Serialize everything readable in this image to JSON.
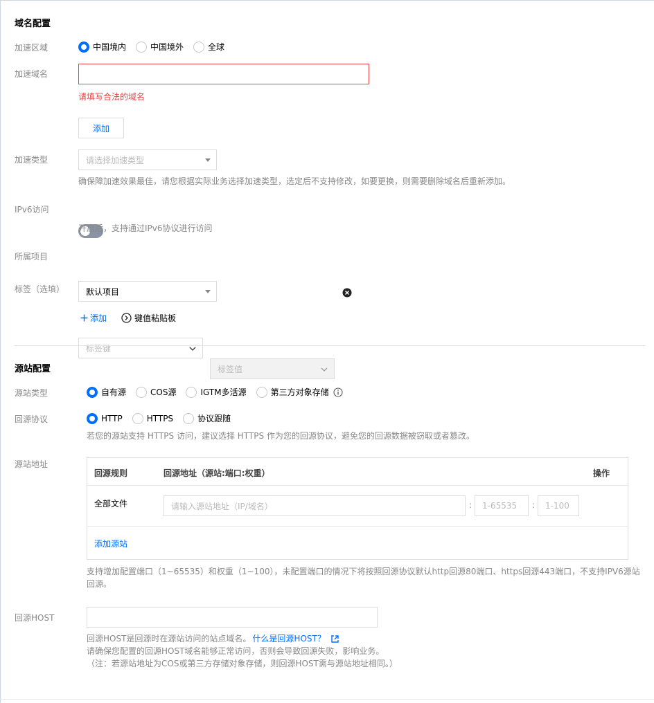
{
  "domain_config": {
    "title": "域名配置",
    "region": {
      "label": "加速区域",
      "options": [
        "中国境内",
        "中国境外",
        "全球"
      ],
      "selected": 0
    },
    "domain": {
      "label": "加速域名",
      "value": "",
      "error": "请填写合法的域名",
      "add_button": "添加"
    },
    "type": {
      "label": "加速类型",
      "placeholder": "请选择加速类型",
      "help": "确保障加速效果最佳，请您根据实际业务选择加速类型，选定后不支持修改，如要更换，则需要删除域名后重新添加。"
    },
    "ipv6": {
      "label": "IPv6访问",
      "enabled": false,
      "help": "开启后，支持通过IPv6协议进行访问"
    },
    "project": {
      "label": "所属项目",
      "value": "默认项目"
    },
    "tags": {
      "label": "标签（选填）",
      "key_placeholder": "标签键",
      "value_placeholder": "标签值",
      "add_link": "添加",
      "paste_link": "键值粘贴板"
    }
  },
  "origin_config": {
    "title": "源站配置",
    "origin_type": {
      "label": "源站类型",
      "options": [
        "自有源",
        "COS源",
        "IGTM多活源",
        "第三方对象存储"
      ],
      "selected": 0
    },
    "protocol": {
      "label": "回源协议",
      "options": [
        "HTTP",
        "HTTPS",
        "协议跟随"
      ],
      "selected": 0,
      "help": "若您的源站支持 HTTPS 访问，建议选择 HTTPS 作为您的回源协议，避免您的回源数据被窃取或者篡改。"
    },
    "address": {
      "label": "源站地址",
      "columns": [
        "回源规则",
        "回源地址（源站:端口:权重）",
        "操作"
      ],
      "rows": [
        {
          "rule": "全部文件",
          "address_placeholder": "请输入源站地址（IP/域名）",
          "port_placeholder": "1-65535",
          "weight_placeholder": "1-100"
        }
      ],
      "add_link": "添加源站",
      "help_line1": "支持增加配置端口（1~65535）和权重（1~100），未配置端口的情况下将按照回源协议默认http回源80端口、https回源443端口，不支持IPV6源站",
      "help_line2": "回源。"
    },
    "host": {
      "label": "回源HOST",
      "value": "",
      "help_prefix": "回源HOST是回源时在源站访问的站点域名。",
      "help_link": "什么是回源HOST？",
      "help_line2": "请确保您配置的回源HOST域名能够正常访问，否则会导致回源失败，影响业务。",
      "help_line3": "（注：若源站地址为COS或第三方存储对象存储，则回源HOST需与源站地址相同。）"
    }
  },
  "colors": {
    "accent": "#006eff",
    "error": "#e54545",
    "muted": "#888888",
    "border": "#dcdcdc"
  }
}
